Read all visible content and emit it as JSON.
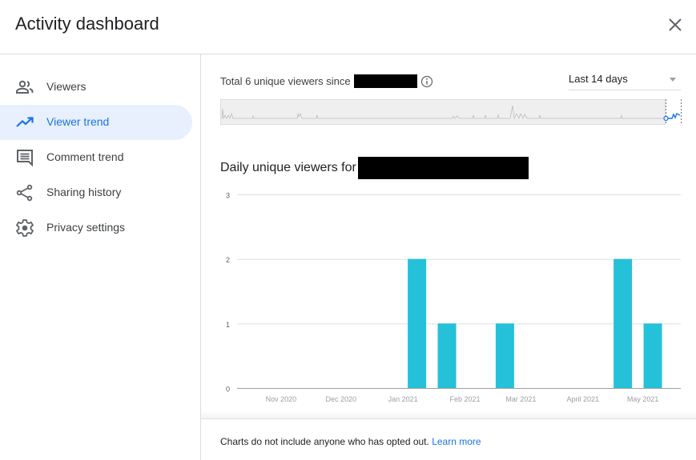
{
  "dialog": {
    "title": "Activity dashboard",
    "close_icon": "close-icon"
  },
  "sidebar": {
    "items": [
      {
        "label": "Viewers",
        "icon": "people-icon",
        "active": false
      },
      {
        "label": "Viewer trend",
        "icon": "trending-up-icon",
        "active": true
      },
      {
        "label": "Comment trend",
        "icon": "comment-icon",
        "active": false
      },
      {
        "label": "Sharing history",
        "icon": "share-icon",
        "active": false
      },
      {
        "label": "Privacy settings",
        "icon": "gear-icon",
        "active": false
      }
    ]
  },
  "main": {
    "total_prefix": "Total ",
    "total_count": "6",
    "total_suffix": " unique viewers since",
    "range_select": {
      "value": "Last 14 days"
    },
    "chart_title_prefix": "Daily unique viewers for",
    "footer_text": "Charts do not include anyone who has opted out. ",
    "footer_link": "Learn more"
  },
  "colors": {
    "accent": "#1a73e8",
    "bar": "#24c1d9",
    "active_bg": "#e8f0fe"
  },
  "chart_data": {
    "type": "bar",
    "title": "Daily unique viewers for [redacted]",
    "xlabel": "",
    "ylabel": "",
    "ylim": [
      0,
      3
    ],
    "yticks": [
      0,
      1,
      2,
      3
    ],
    "xtick_labels": [
      "Nov 2020",
      "Dec 2020",
      "Jan 2021",
      "Feb 2021",
      "Mar 2021",
      "April 2021",
      "May 2021"
    ],
    "x_domain_days": [
      0,
      222
    ],
    "xtick_days": [
      22,
      52,
      83,
      114,
      142,
      173,
      203
    ],
    "bars": [
      {
        "day": 90,
        "value": 2
      },
      {
        "day": 105,
        "value": 1
      },
      {
        "day": 134,
        "value": 1
      },
      {
        "day": 193,
        "value": 2
      },
      {
        "day": 208,
        "value": 1
      }
    ],
    "grid": true,
    "legend": "none"
  }
}
